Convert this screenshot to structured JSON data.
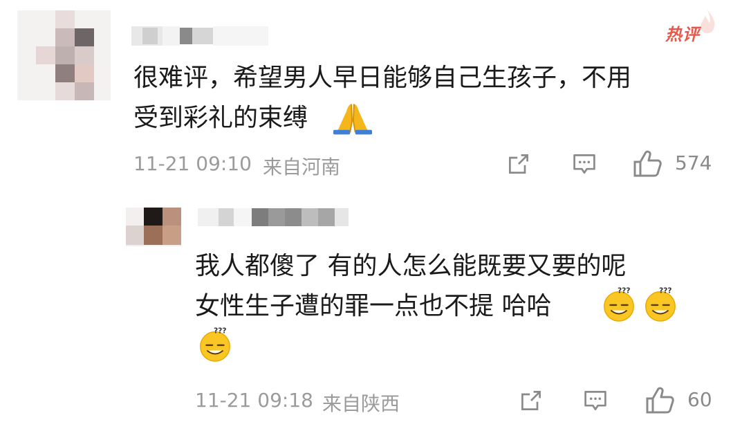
{
  "comments": [
    {
      "badge": "热评",
      "text_line1": "很难评，希望男人早日能够自己生孩子，不用",
      "text_line2": "受到彩礼的束缚",
      "emoji_icon": "folded-hands-emoji",
      "time": "11-21 09:10",
      "location": "来自河南",
      "likes": "574",
      "icons": [
        "share-icon",
        "comment-icon",
        "thumbs-up-icon"
      ]
    },
    {
      "text_line1": "我人都傻了 有的人怎么能既要又要的呢",
      "text_line2": "女性生子遭的罪一点也不提 哈哈",
      "emoji_icon": "dizzy-grin-emoji",
      "time": "11-21 09:18",
      "location": "来自陕西",
      "likes": "60",
      "icons": [
        "share-icon",
        "comment-icon",
        "thumbs-up-icon"
      ]
    }
  ],
  "colors": {
    "text": "#1a1a1a",
    "meta": "#9b9b9b",
    "hot": "#e8574a",
    "icon": "#8a8a8a"
  }
}
